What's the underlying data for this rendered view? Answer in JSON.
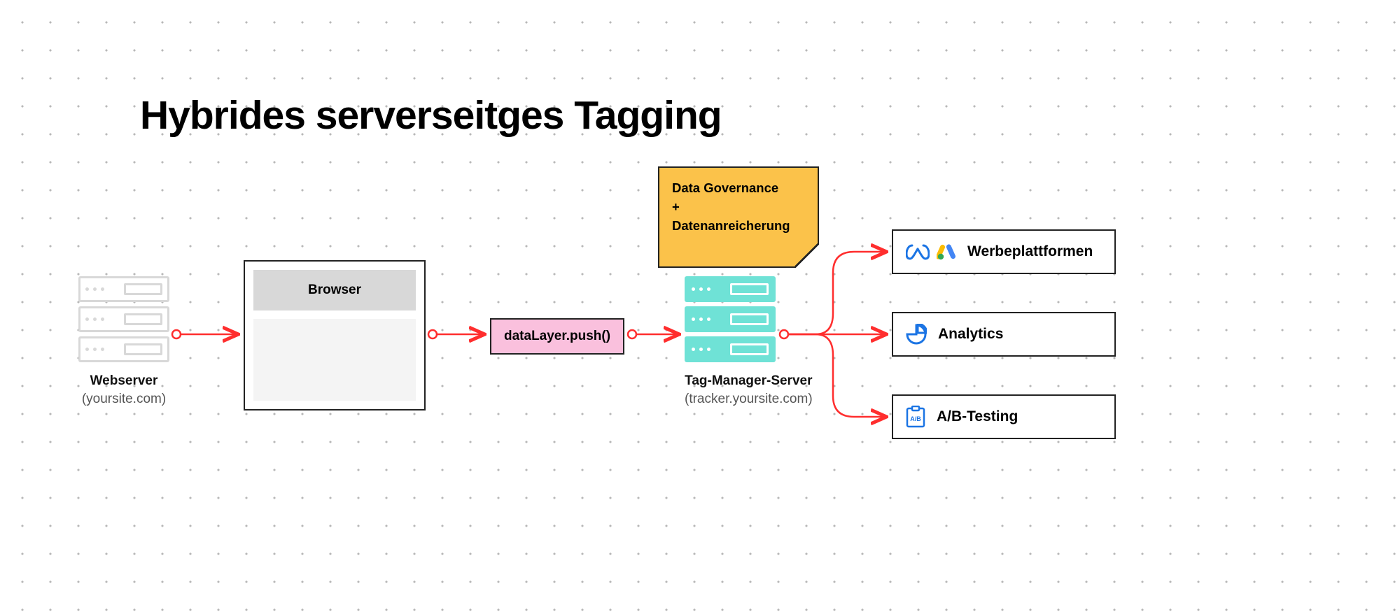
{
  "title": "Hybrides serverseitges Tagging",
  "webserver": {
    "name": "Webserver",
    "sub": "(yoursite.com)"
  },
  "browser": {
    "bar_label": "Browser"
  },
  "datalayer": {
    "label": "dataLayer.push()"
  },
  "sticky": {
    "line1": "Data Governance",
    "line2": "+",
    "line3": "Datenanreicherung"
  },
  "tagmanager": {
    "name": "Tag-Manager-Server",
    "sub": "(tracker.yoursite.com)"
  },
  "destinations": {
    "ads": "Werbeplattformen",
    "analytics": "Analytics",
    "ab": "A/B-Testing"
  }
}
